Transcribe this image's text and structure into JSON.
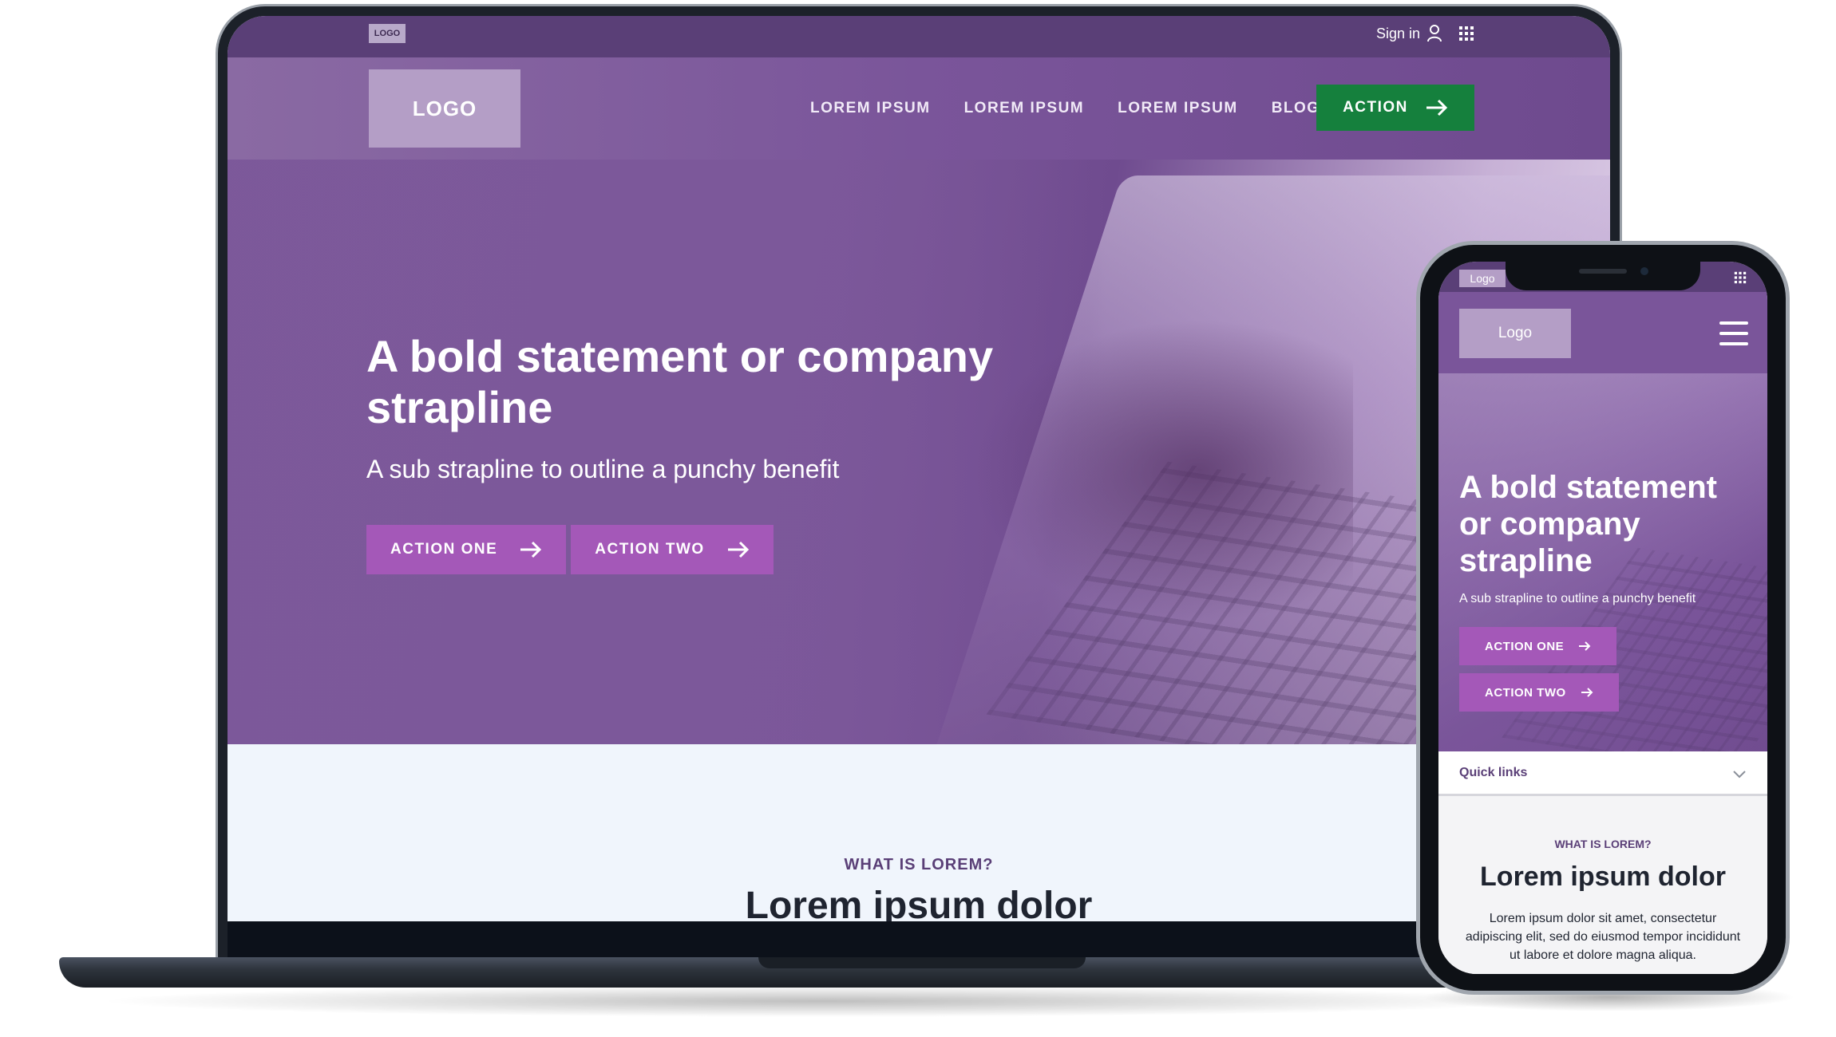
{
  "desktop": {
    "util_bar": {
      "logo": "LOGO",
      "sign_in": "Sign in"
    },
    "nav": {
      "logo": "LOGO",
      "links": [
        "LOREM IPSUM",
        "LOREM IPSUM",
        "LOREM IPSUM",
        "BLOG"
      ],
      "action_label": "ACTION",
      "action_color": "#15803d"
    },
    "hero": {
      "title": "A bold statement or company strapline",
      "subtitle": "A sub strapline to outline a punchy benefit",
      "action_one": "ACTION ONE",
      "action_two": "ACTION TWO",
      "button_color": "#a458b8"
    },
    "section": {
      "kicker": "WHAT IS LOREM?",
      "title": "Lorem ipsum dolor"
    }
  },
  "mobile": {
    "util_bar": {
      "logo": "Logo"
    },
    "nav": {
      "logo": "Logo"
    },
    "hero": {
      "title": "A bold statement or company strapline",
      "subtitle": "A sub strapline to outline a punchy benefit",
      "action_one": "ACTION ONE",
      "action_two": "ACTION TWO"
    },
    "quick_links": {
      "label": "Quick links"
    },
    "section": {
      "kicker": "WHAT IS LOREM?",
      "title": "Lorem ipsum dolor",
      "body": "Lorem ipsum dolor sit amet, consectetur adipiscing elit, sed do eiusmod tempor incididunt ut labore et dolore magna aliqua."
    }
  },
  "icons": {
    "user": "user-icon",
    "grid": "grid-icon",
    "arrow": "arrow-right-icon",
    "menu": "hamburger-menu-icon",
    "chevron": "chevron-down-icon"
  },
  "colors": {
    "brand_purple": "#7a559a",
    "dark_purple": "#5a3f77",
    "accent_green": "#15803d"
  }
}
